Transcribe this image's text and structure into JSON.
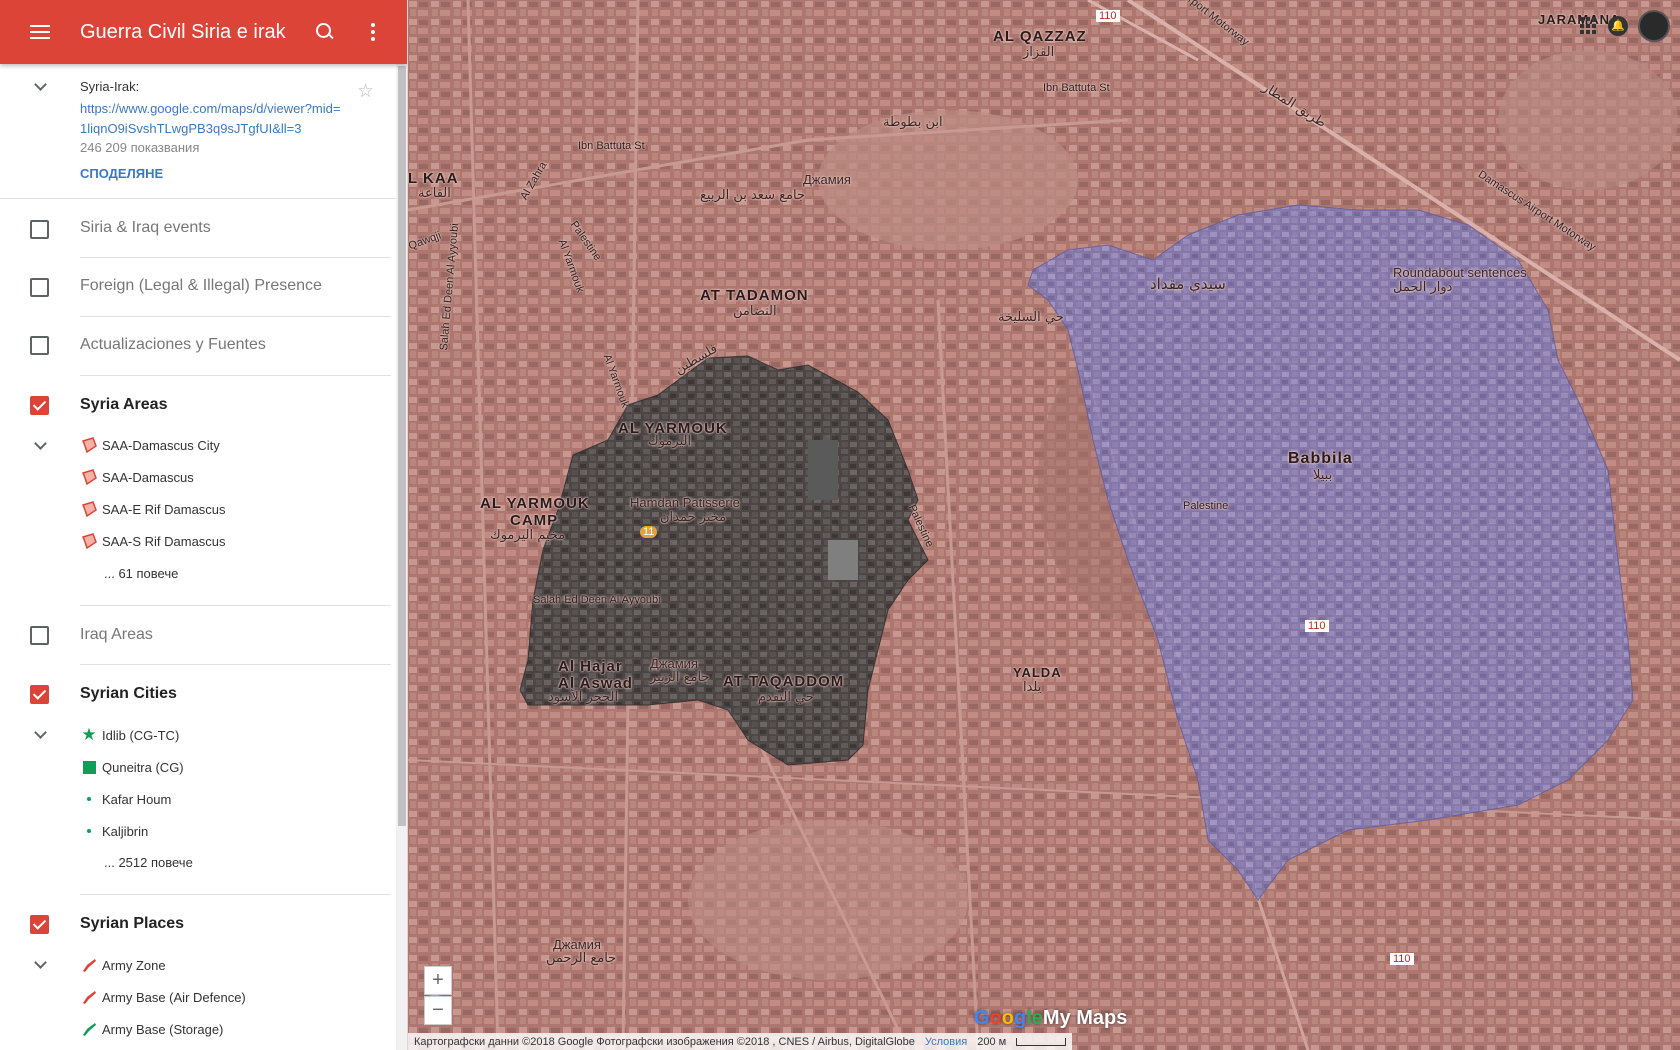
{
  "header": {
    "title": "Guerra Civil Siria e irak",
    "menu_icon": "menu-icon",
    "search_icon": "search-icon",
    "more_icon": "more-vert-icon",
    "color": "#db4437"
  },
  "info": {
    "label": "Syria-Irak:",
    "url": "https://www.google.com/maps/d/viewer?mid=1liqnO9iSvshTLwgPB3q9sJTgfUI&ll=3",
    "views": "246 209 показвания",
    "share": "СПОДЕЛЯНЕ"
  },
  "layers": [
    {
      "name": "Siria & Iraq events",
      "checked": false
    },
    {
      "name": "Foreign (Legal & Illegal) Presence",
      "checked": false
    },
    {
      "name": "Actualizaciones y Fuentes",
      "checked": false
    },
    {
      "name": "Syria Areas",
      "checked": true,
      "items": [
        "SAA-Damascus City",
        "SAA-Damascus",
        "SAA-E Rif Damascus",
        "SAA-S Rif Damascus"
      ],
      "more": "... 61 повече"
    },
    {
      "name": "Iraq Areas",
      "checked": false
    },
    {
      "name": "Syrian Cities",
      "checked": true,
      "items": [
        "Idlib (CG-TC)",
        "Quneitra (CG)",
        "Kafar Houm",
        "Kaljibrin"
      ],
      "more": "... 2512 повече"
    },
    {
      "name": "Syrian Places",
      "checked": true,
      "items": [
        "Army Zone",
        "Army Base (Air Defence)",
        "Army Base (Storage)"
      ]
    }
  ],
  "map": {
    "labels": {
      "al_qazzaz": "AL QAZZAZ",
      "al_qazzaz_ar": "القزاز",
      "ibn_battuta": "Ibn Battuta St",
      "ibn_battuta_ar": "ابن بطوطة",
      "ibn_battuta_2": "Ibn Battuta St",
      "airport_mw": "Airport Motorway",
      "airport_rd_ar": "طريق المطار",
      "damascus_airport_mw": "Damascus Airport Motorway",
      "kaa": "L KAA",
      "kaa_ar": "القاعة",
      "zahra": "Al Zahra",
      "qawqji": "Qawqji",
      "jamia1": "Джамия",
      "jamia1_ar": "جامع سعد بن الربيع",
      "salah_vertical": "Salah Ed Deen Al Ayyoubi",
      "al_yarmouk_rd": "Al Yarmouk",
      "palestine_rd": "Palestine",
      "at_tadamon": "AT TADAMON",
      "at_tadamon_ar": "التضامن",
      "palestine_ar": "فلسطين",
      "al_yarmouk_2": "Al Yarmouk",
      "al_yarmouk": "AL YARMOUK",
      "al_yarmouk_ar": "اليرموك",
      "al_yarmouk_camp": "AL YARMOUK",
      "camp": "CAMP",
      "camp_ar": "مخيم اليرموك",
      "hamdan": "Hamdan Patisserie",
      "hamdan_ar": "مخبز حمدان",
      "salah_ed_deen": "Salah Ed Deen Al Ayyoubi",
      "al_hajar": "Al Hajar",
      "al_aswad": "Al Aswad",
      "al_hajar_ar": "الحجر الأسود",
      "jamia2": "Джамия",
      "jamia2_ar": "جامع الزبير",
      "at_taqaddom": "AT TAQADDOM",
      "at_taqaddom_ar": "حي التقدم",
      "palestine_2": "Palestine",
      "sayyida": "سيدي مقداد",
      "roundabout": "Roundabout sentences",
      "roundabout_ar": "دوار الجمل",
      "silikhah_ar": "حي السليخة",
      "babbila": "Babbila",
      "babbila_ar": "ببيلا",
      "palestine_3": "Palestine",
      "yalda": "YALDA",
      "yalda_ar": "يلدا",
      "jamia3": "Джамия",
      "jamia3_ar": "جامع الرحمن",
      "jaramana": "JARAMANA",
      "route_110": "110",
      "badge_11": "11"
    },
    "regions": [
      {
        "name": "Yarmouk dark zone",
        "color": "#3c3c3c"
      },
      {
        "name": "Babbila blue zone",
        "color": "#6c6fb4"
      }
    ],
    "zoom_in": "+",
    "zoom_out": "−",
    "logo": {
      "g1": "G",
      "g2": "o",
      "g3": "o",
      "g4": "g",
      "rest": "le",
      "my_maps": "My Maps"
    },
    "attribution": "Картографски данни ©2018 Google Фотографски изображения ©2018 , CNES / Airbus, DigitalGlobe",
    "terms": "Условия",
    "scale": "200 м"
  }
}
